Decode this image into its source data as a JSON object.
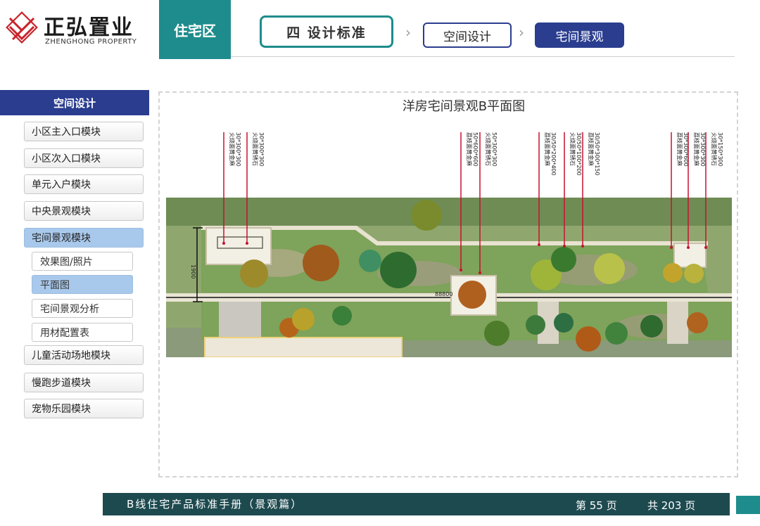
{
  "header": {
    "brand_cn": "正弘置业",
    "brand_en": "ZHENGHONG PROPERTY",
    "section": "住宅区",
    "chapter": "四  设计标准",
    "breadcrumb": [
      "空间设计",
      "宅间景观"
    ]
  },
  "sidebar": {
    "title": "空间设计",
    "items": [
      {
        "label": "小区主入口模块"
      },
      {
        "label": "小区次入口模块"
      },
      {
        "label": "单元入户模块"
      },
      {
        "label": "中央景观模块"
      },
      {
        "label": "宅间景观模块"
      },
      {
        "label": "儿童活动场地模块"
      },
      {
        "label": "慢跑步道模块"
      },
      {
        "label": "宠物乐园模块"
      }
    ],
    "subitems": [
      {
        "label": "效果图/照片"
      },
      {
        "label": "平面图"
      },
      {
        "label": "宅间景观分析"
      },
      {
        "label": "用材配置表"
      }
    ],
    "active_item": "宅间景观模块",
    "active_subitem": "平面图"
  },
  "main": {
    "title": "洋房宅间景观B平面图",
    "dimension_label": "88800",
    "height_dimension": "1900",
    "callouts": [
      {
        "lines": [
          "30*300*300",
          "火烧面黄金麻"
        ]
      },
      {
        "lines": [
          "30*300*300",
          "火烧面黄锈石"
        ]
      },
      {
        "lines": [
          "50*600*600",
          "荔枝面黄金麻"
        ]
      },
      {
        "lines": [
          "50*300*300",
          "火烧面黄锈石"
        ]
      },
      {
        "lines": [
          "30/50*200*400",
          "荔枝面黄金麻"
        ]
      },
      {
        "lines": [
          "30/50*100*200",
          "火烧面黄锈石"
        ]
      },
      {
        "lines": [
          "30/50*300*150",
          "荔枝面黄金麻"
        ]
      },
      {
        "lines": [
          "30*300*600",
          "荔枝面黄金麻"
        ]
      },
      {
        "lines": [
          "30*300*300",
          "荔枝面黄金麻"
        ]
      },
      {
        "lines": [
          "30*150*300",
          "火烧面黄锈石"
        ]
      }
    ]
  },
  "footer": {
    "title": "B线住宅产品标准手册（景观篇）",
    "page": "第 55 页",
    "total": "共 203 页"
  },
  "colors": {
    "teal": "#1e8c8c",
    "navy": "#2a3d8f",
    "footer": "#1d4a4f",
    "active_nav": "#a9c9ec",
    "callout_line": "#c8102e",
    "lawn": "#7ea35a"
  }
}
